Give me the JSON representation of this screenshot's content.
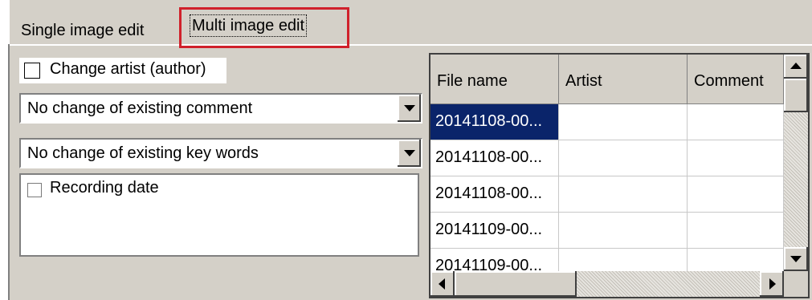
{
  "tabs": {
    "single_label": "Single image edit",
    "multi_label": "Multi image edit"
  },
  "options": {
    "change_artist_label": "Change artist (author)",
    "change_artist_checked": false,
    "comment_select_value": "No change of existing comment",
    "keywords_select_value": "No change of existing key words",
    "recording_date_label": "Recording date",
    "recording_date_checked": false
  },
  "grid": {
    "columns": [
      "File name",
      "Artist",
      "Comment"
    ],
    "rows": [
      {
        "file": "20141108-00...",
        "artist": "",
        "comment": "",
        "selected": true
      },
      {
        "file": "20141108-00...",
        "artist": "",
        "comment": ""
      },
      {
        "file": "20141108-00...",
        "artist": "",
        "comment": ""
      },
      {
        "file": "20141109-00...",
        "artist": "",
        "comment": ""
      },
      {
        "file": "20141109-00...",
        "artist": "",
        "comment": ""
      }
    ]
  },
  "colors": {
    "highlight_box": "#d0212b",
    "selected_row": "#0a246a",
    "window_bg": "#d4d0c8"
  }
}
